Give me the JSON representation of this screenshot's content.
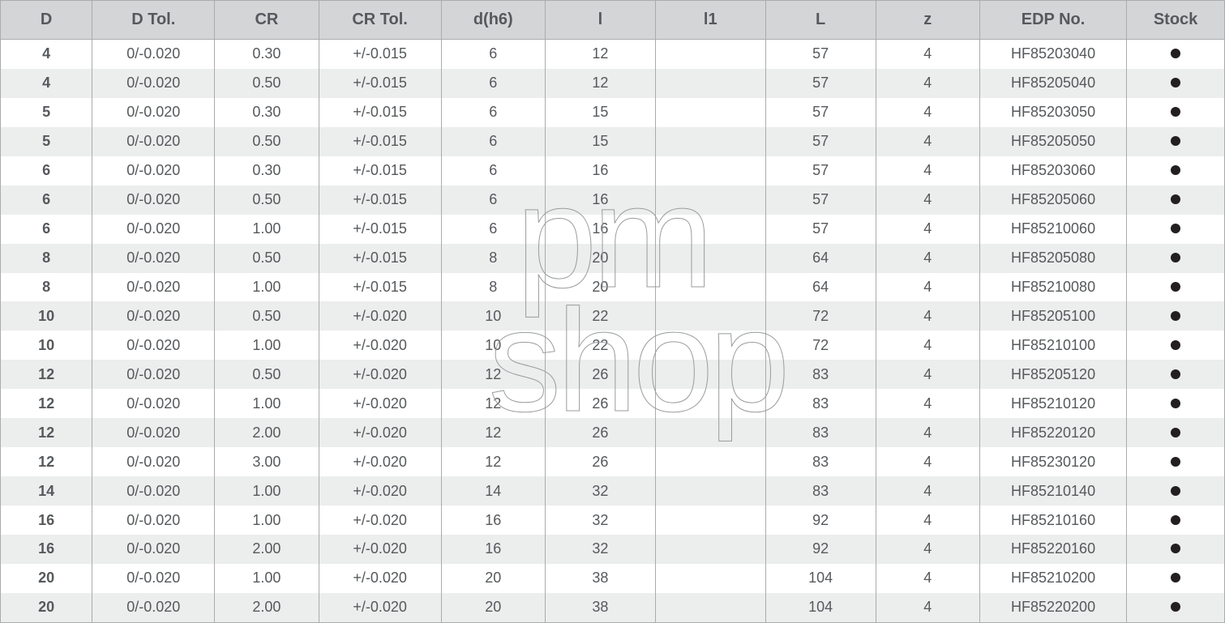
{
  "watermark": {
    "line1": "pm",
    "line2": "shop"
  },
  "headers": {
    "d": "D",
    "dtol": "D Tol.",
    "cr": "CR",
    "crtol": "CR Tol.",
    "dh6": "d(h6)",
    "l": "l",
    "l1": "l1",
    "L": "L",
    "z": "z",
    "edp": "EDP No.",
    "stock": "Stock"
  },
  "rows": [
    {
      "d": "4",
      "dtol": "0/-0.020",
      "cr": "0.30",
      "crtol": "+/-0.015",
      "dh6": "6",
      "l": "12",
      "l1": "",
      "L": "57",
      "z": "4",
      "edp": "HF85203040",
      "stock": true
    },
    {
      "d": "4",
      "dtol": "0/-0.020",
      "cr": "0.50",
      "crtol": "+/-0.015",
      "dh6": "6",
      "l": "12",
      "l1": "",
      "L": "57",
      "z": "4",
      "edp": "HF85205040",
      "stock": true
    },
    {
      "d": "5",
      "dtol": "0/-0.020",
      "cr": "0.30",
      "crtol": "+/-0.015",
      "dh6": "6",
      "l": "15",
      "l1": "",
      "L": "57",
      "z": "4",
      "edp": "HF85203050",
      "stock": true
    },
    {
      "d": "5",
      "dtol": "0/-0.020",
      "cr": "0.50",
      "crtol": "+/-0.015",
      "dh6": "6",
      "l": "15",
      "l1": "",
      "L": "57",
      "z": "4",
      "edp": "HF85205050",
      "stock": true
    },
    {
      "d": "6",
      "dtol": "0/-0.020",
      "cr": "0.30",
      "crtol": "+/-0.015",
      "dh6": "6",
      "l": "16",
      "l1": "",
      "L": "57",
      "z": "4",
      "edp": "HF85203060",
      "stock": true
    },
    {
      "d": "6",
      "dtol": "0/-0.020",
      "cr": "0.50",
      "crtol": "+/-0.015",
      "dh6": "6",
      "l": "16",
      "l1": "",
      "L": "57",
      "z": "4",
      "edp": "HF85205060",
      "stock": true
    },
    {
      "d": "6",
      "dtol": "0/-0.020",
      "cr": "1.00",
      "crtol": "+/-0.015",
      "dh6": "6",
      "l": "16",
      "l1": "",
      "L": "57",
      "z": "4",
      "edp": "HF85210060",
      "stock": true
    },
    {
      "d": "8",
      "dtol": "0/-0.020",
      "cr": "0.50",
      "crtol": "+/-0.015",
      "dh6": "8",
      "l": "20",
      "l1": "",
      "L": "64",
      "z": "4",
      "edp": "HF85205080",
      "stock": true
    },
    {
      "d": "8",
      "dtol": "0/-0.020",
      "cr": "1.00",
      "crtol": "+/-0.015",
      "dh6": "8",
      "l": "20",
      "l1": "",
      "L": "64",
      "z": "4",
      "edp": "HF85210080",
      "stock": true
    },
    {
      "d": "10",
      "dtol": "0/-0.020",
      "cr": "0.50",
      "crtol": "+/-0.020",
      "dh6": "10",
      "l": "22",
      "l1": "",
      "L": "72",
      "z": "4",
      "edp": "HF85205100",
      "stock": true
    },
    {
      "d": "10",
      "dtol": "0/-0.020",
      "cr": "1.00",
      "crtol": "+/-0.020",
      "dh6": "10",
      "l": "22",
      "l1": "",
      "L": "72",
      "z": "4",
      "edp": "HF85210100",
      "stock": true
    },
    {
      "d": "12",
      "dtol": "0/-0.020",
      "cr": "0.50",
      "crtol": "+/-0.020",
      "dh6": "12",
      "l": "26",
      "l1": "",
      "L": "83",
      "z": "4",
      "edp": "HF85205120",
      "stock": true
    },
    {
      "d": "12",
      "dtol": "0/-0.020",
      "cr": "1.00",
      "crtol": "+/-0.020",
      "dh6": "12",
      "l": "26",
      "l1": "",
      "L": "83",
      "z": "4",
      "edp": "HF85210120",
      "stock": true
    },
    {
      "d": "12",
      "dtol": "0/-0.020",
      "cr": "2.00",
      "crtol": "+/-0.020",
      "dh6": "12",
      "l": "26",
      "l1": "",
      "L": "83",
      "z": "4",
      "edp": "HF85220120",
      "stock": true
    },
    {
      "d": "12",
      "dtol": "0/-0.020",
      "cr": "3.00",
      "crtol": "+/-0.020",
      "dh6": "12",
      "l": "26",
      "l1": "",
      "L": "83",
      "z": "4",
      "edp": "HF85230120",
      "stock": true
    },
    {
      "d": "14",
      "dtol": "0/-0.020",
      "cr": "1.00",
      "crtol": "+/-0.020",
      "dh6": "14",
      "l": "32",
      "l1": "",
      "L": "83",
      "z": "4",
      "edp": "HF85210140",
      "stock": true
    },
    {
      "d": "16",
      "dtol": "0/-0.020",
      "cr": "1.00",
      "crtol": "+/-0.020",
      "dh6": "16",
      "l": "32",
      "l1": "",
      "L": "92",
      "z": "4",
      "edp": "HF85210160",
      "stock": true
    },
    {
      "d": "16",
      "dtol": "0/-0.020",
      "cr": "2.00",
      "crtol": "+/-0.020",
      "dh6": "16",
      "l": "32",
      "l1": "",
      "L": "92",
      "z": "4",
      "edp": "HF85220160",
      "stock": true
    },
    {
      "d": "20",
      "dtol": "0/-0.020",
      "cr": "1.00",
      "crtol": "+/-0.020",
      "dh6": "20",
      "l": "38",
      "l1": "",
      "L": "104",
      "z": "4",
      "edp": "HF85210200",
      "stock": true
    },
    {
      "d": "20",
      "dtol": "0/-0.020",
      "cr": "2.00",
      "crtol": "+/-0.020",
      "dh6": "20",
      "l": "38",
      "l1": "",
      "L": "104",
      "z": "4",
      "edp": "HF85220200",
      "stock": true
    }
  ]
}
